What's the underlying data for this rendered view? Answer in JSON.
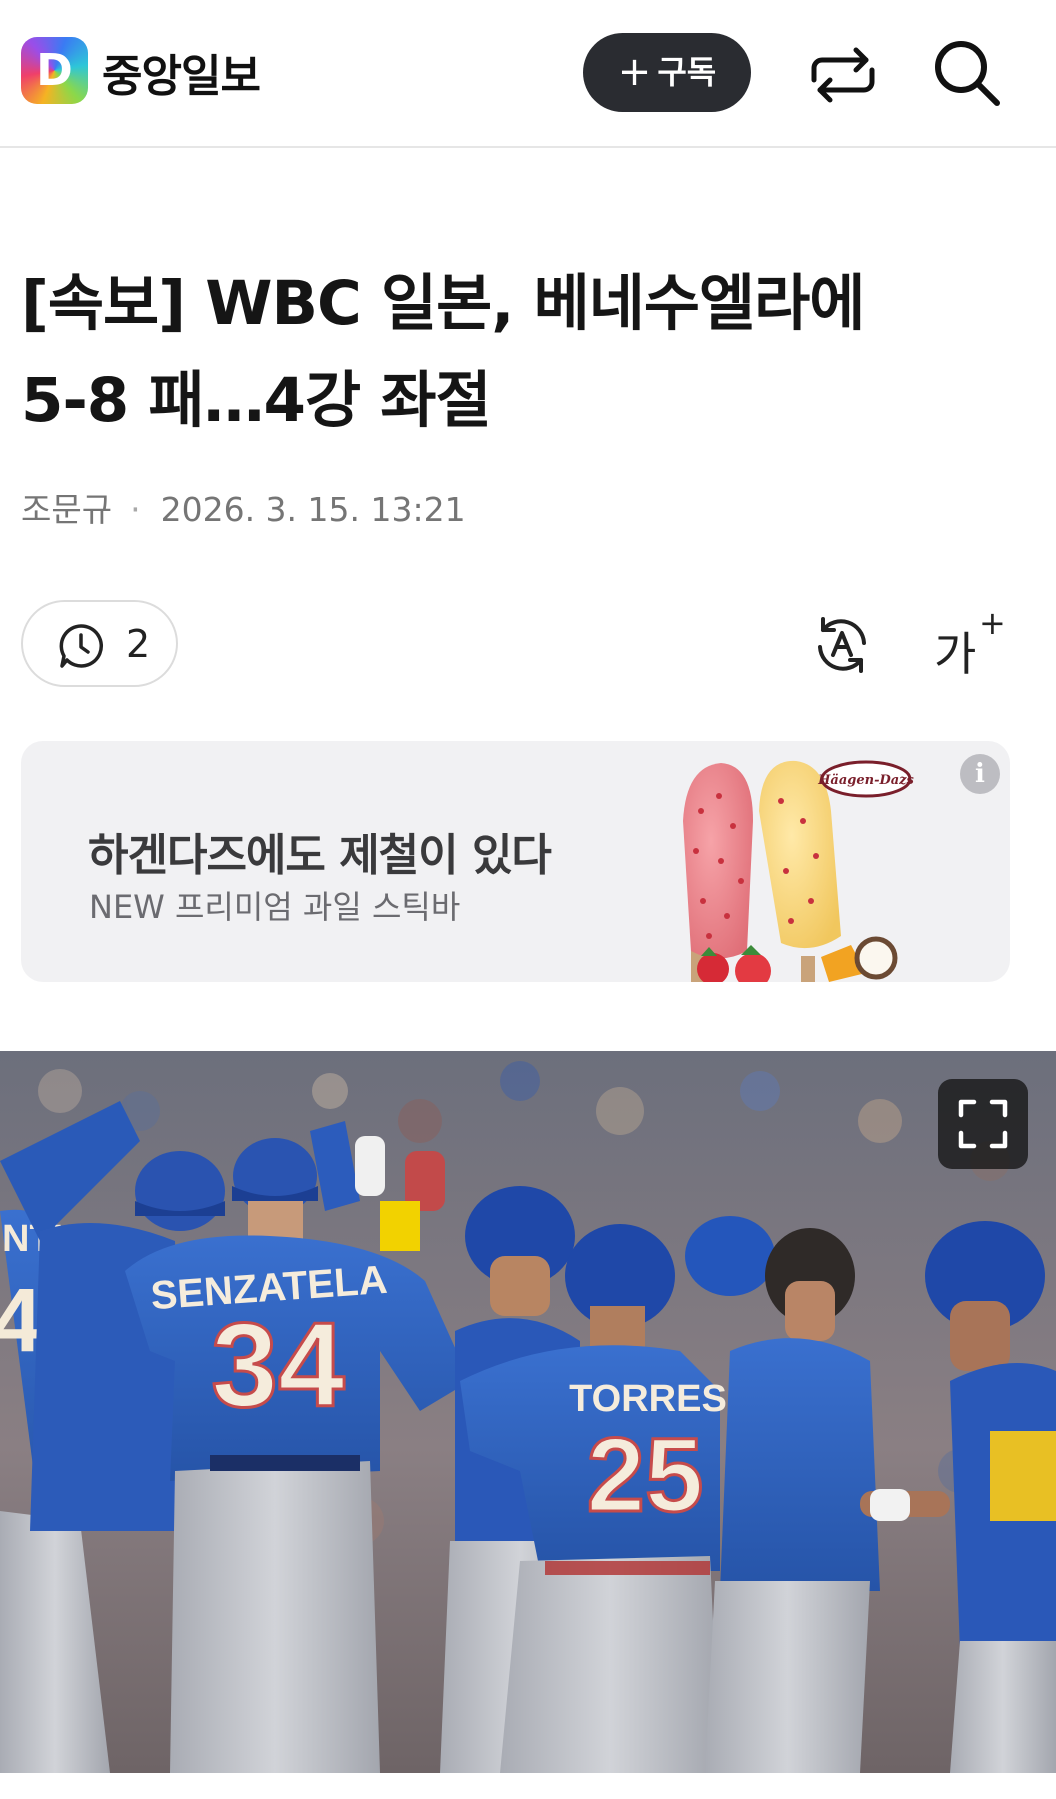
{
  "header": {
    "logo_letter": "D",
    "brand": "중앙일보",
    "subscribe_label": "구독"
  },
  "article": {
    "title_line1": "[속보] WBC 일본, 베네수엘라에",
    "title_line2": "5-8 패…4강 좌절",
    "author": "조문규",
    "separator": "·",
    "datetime": "2026. 3. 15. 13:21",
    "comment_count": "2",
    "font_size_label": "가",
    "font_size_plus": "+"
  },
  "ad": {
    "headline": "하겐다즈에도 제철이 있다",
    "sub": "NEW 프리미엄 과일 스틱바",
    "brand_logo": "Häagen-Dazs",
    "info_icon": "i"
  },
  "photo": {
    "jerseys": [
      {
        "name": "SENZATELA",
        "number": "34"
      },
      {
        "name": "TORRES",
        "number": "25"
      }
    ],
    "partial_jersey_text": "NTI",
    "partial_jersey_number": "4",
    "colors": {
      "jersey": "#2f62c0",
      "pants": "#c4c6cc",
      "helmet": "#1f48a8"
    }
  }
}
